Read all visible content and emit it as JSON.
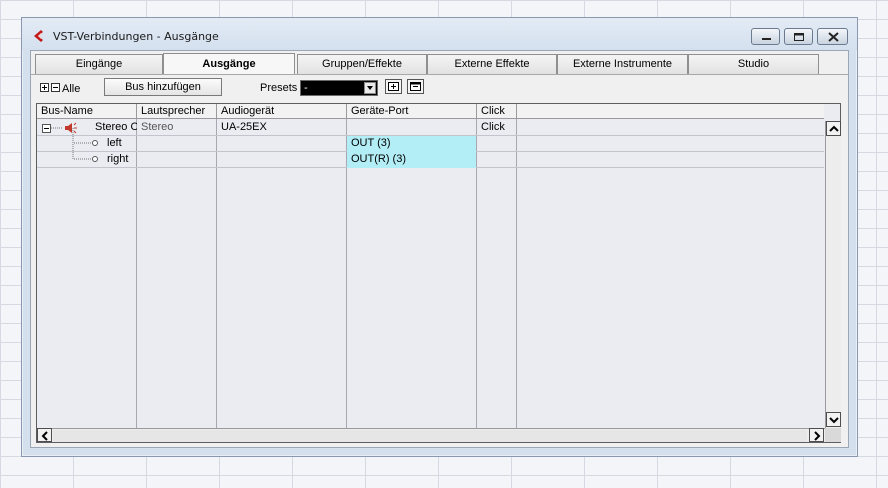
{
  "window": {
    "title": "VST-Verbindungen - Ausgänge",
    "icon": "cubase-logo-icon"
  },
  "tabs": [
    {
      "label": "Eingänge",
      "active": false
    },
    {
      "label": "Ausgänge",
      "active": true
    },
    {
      "label": "Gruppen/Effekte",
      "active": false
    },
    {
      "label": "Externe Effekte",
      "active": false
    },
    {
      "label": "Externe Instrumente",
      "active": false
    },
    {
      "label": "Studio",
      "active": false
    }
  ],
  "toolbar": {
    "all_label": "Alle",
    "add_bus_label": "Bus hinzufügen",
    "presets_label": "Presets",
    "presets_value": "-"
  },
  "table": {
    "columns": [
      "Bus-Name",
      "Lautsprecher",
      "Audiogerät",
      "Geräte-Port",
      "Click"
    ],
    "rows": [
      {
        "bus_name": "Stereo Out",
        "speaker": "Stereo",
        "device": "UA-25EX",
        "port": "",
        "click": "Click"
      },
      {
        "bus_name": "left",
        "speaker": "",
        "device": "",
        "port": "OUT (3)",
        "click": ""
      },
      {
        "bus_name": "right",
        "speaker": "",
        "device": "",
        "port": "OUT(R) (3)",
        "click": ""
      }
    ]
  },
  "colors": {
    "port_highlight": "#b3eef6",
    "window_frame": "#d4e0ee",
    "speaker_icon": "#c0392b"
  }
}
